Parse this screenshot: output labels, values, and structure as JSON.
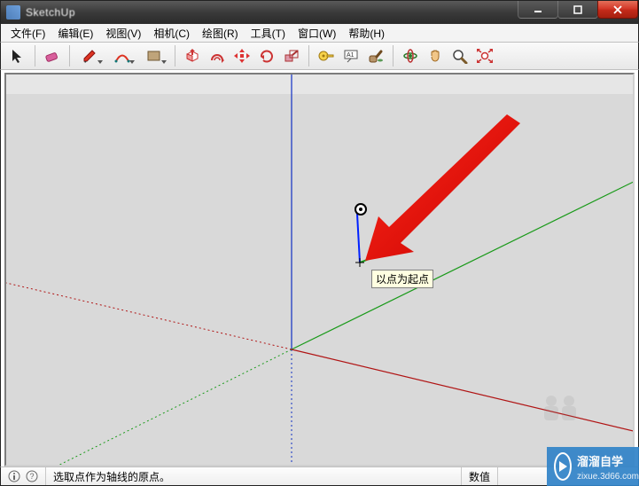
{
  "window": {
    "title": "SketchUp"
  },
  "menus": {
    "file": "文件(F)",
    "edit": "编辑(E)",
    "view": "视图(V)",
    "camera": "相机(C)",
    "draw": "绘图(R)",
    "tools": "工具(T)",
    "window": "窗口(W)",
    "help": "帮助(H)"
  },
  "toolbar": {
    "select": "select",
    "eraser": "eraser",
    "pencil": "pencil",
    "arc": "arc",
    "shape": "shape",
    "pushpull": "pushpull",
    "offset": "offset",
    "move": "move",
    "rotate": "rotate",
    "scale": "scale",
    "tape": "tape",
    "text": "text",
    "paint": "paint",
    "orbit": "orbit",
    "pan": "pan",
    "zoom": "zoom",
    "zoomext": "zoomext"
  },
  "viewport": {
    "tooltip": "以点为起点"
  },
  "status": {
    "hint": "选取点作为轴线的原点。",
    "value_label": "数值"
  },
  "watermark": {
    "line1": "溜溜自学",
    "line2": "zixue.3d66.com"
  }
}
